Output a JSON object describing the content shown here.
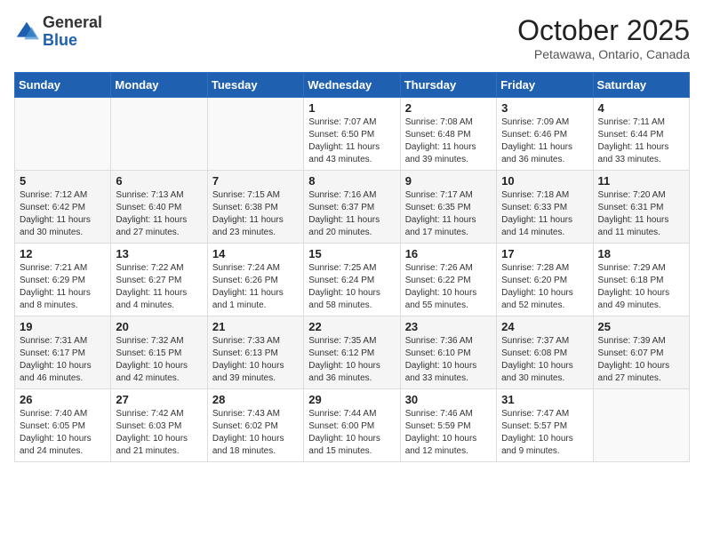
{
  "header": {
    "logo_general": "General",
    "logo_blue": "Blue",
    "month_title": "October 2025",
    "location": "Petawawa, Ontario, Canada"
  },
  "days_of_week": [
    "Sunday",
    "Monday",
    "Tuesday",
    "Wednesday",
    "Thursday",
    "Friday",
    "Saturday"
  ],
  "weeks": [
    [
      {
        "day": "",
        "sunrise": "",
        "sunset": "",
        "daylight": ""
      },
      {
        "day": "",
        "sunrise": "",
        "sunset": "",
        "daylight": ""
      },
      {
        "day": "",
        "sunrise": "",
        "sunset": "",
        "daylight": ""
      },
      {
        "day": "1",
        "sunrise": "Sunrise: 7:07 AM",
        "sunset": "Sunset: 6:50 PM",
        "daylight": "Daylight: 11 hours and 43 minutes."
      },
      {
        "day": "2",
        "sunrise": "Sunrise: 7:08 AM",
        "sunset": "Sunset: 6:48 PM",
        "daylight": "Daylight: 11 hours and 39 minutes."
      },
      {
        "day": "3",
        "sunrise": "Sunrise: 7:09 AM",
        "sunset": "Sunset: 6:46 PM",
        "daylight": "Daylight: 11 hours and 36 minutes."
      },
      {
        "day": "4",
        "sunrise": "Sunrise: 7:11 AM",
        "sunset": "Sunset: 6:44 PM",
        "daylight": "Daylight: 11 hours and 33 minutes."
      }
    ],
    [
      {
        "day": "5",
        "sunrise": "Sunrise: 7:12 AM",
        "sunset": "Sunset: 6:42 PM",
        "daylight": "Daylight: 11 hours and 30 minutes."
      },
      {
        "day": "6",
        "sunrise": "Sunrise: 7:13 AM",
        "sunset": "Sunset: 6:40 PM",
        "daylight": "Daylight: 11 hours and 27 minutes."
      },
      {
        "day": "7",
        "sunrise": "Sunrise: 7:15 AM",
        "sunset": "Sunset: 6:38 PM",
        "daylight": "Daylight: 11 hours and 23 minutes."
      },
      {
        "day": "8",
        "sunrise": "Sunrise: 7:16 AM",
        "sunset": "Sunset: 6:37 PM",
        "daylight": "Daylight: 11 hours and 20 minutes."
      },
      {
        "day": "9",
        "sunrise": "Sunrise: 7:17 AM",
        "sunset": "Sunset: 6:35 PM",
        "daylight": "Daylight: 11 hours and 17 minutes."
      },
      {
        "day": "10",
        "sunrise": "Sunrise: 7:18 AM",
        "sunset": "Sunset: 6:33 PM",
        "daylight": "Daylight: 11 hours and 14 minutes."
      },
      {
        "day": "11",
        "sunrise": "Sunrise: 7:20 AM",
        "sunset": "Sunset: 6:31 PM",
        "daylight": "Daylight: 11 hours and 11 minutes."
      }
    ],
    [
      {
        "day": "12",
        "sunrise": "Sunrise: 7:21 AM",
        "sunset": "Sunset: 6:29 PM",
        "daylight": "Daylight: 11 hours and 8 minutes."
      },
      {
        "day": "13",
        "sunrise": "Sunrise: 7:22 AM",
        "sunset": "Sunset: 6:27 PM",
        "daylight": "Daylight: 11 hours and 4 minutes."
      },
      {
        "day": "14",
        "sunrise": "Sunrise: 7:24 AM",
        "sunset": "Sunset: 6:26 PM",
        "daylight": "Daylight: 11 hours and 1 minute."
      },
      {
        "day": "15",
        "sunrise": "Sunrise: 7:25 AM",
        "sunset": "Sunset: 6:24 PM",
        "daylight": "Daylight: 10 hours and 58 minutes."
      },
      {
        "day": "16",
        "sunrise": "Sunrise: 7:26 AM",
        "sunset": "Sunset: 6:22 PM",
        "daylight": "Daylight: 10 hours and 55 minutes."
      },
      {
        "day": "17",
        "sunrise": "Sunrise: 7:28 AM",
        "sunset": "Sunset: 6:20 PM",
        "daylight": "Daylight: 10 hours and 52 minutes."
      },
      {
        "day": "18",
        "sunrise": "Sunrise: 7:29 AM",
        "sunset": "Sunset: 6:18 PM",
        "daylight": "Daylight: 10 hours and 49 minutes."
      }
    ],
    [
      {
        "day": "19",
        "sunrise": "Sunrise: 7:31 AM",
        "sunset": "Sunset: 6:17 PM",
        "daylight": "Daylight: 10 hours and 46 minutes."
      },
      {
        "day": "20",
        "sunrise": "Sunrise: 7:32 AM",
        "sunset": "Sunset: 6:15 PM",
        "daylight": "Daylight: 10 hours and 42 minutes."
      },
      {
        "day": "21",
        "sunrise": "Sunrise: 7:33 AM",
        "sunset": "Sunset: 6:13 PM",
        "daylight": "Daylight: 10 hours and 39 minutes."
      },
      {
        "day": "22",
        "sunrise": "Sunrise: 7:35 AM",
        "sunset": "Sunset: 6:12 PM",
        "daylight": "Daylight: 10 hours and 36 minutes."
      },
      {
        "day": "23",
        "sunrise": "Sunrise: 7:36 AM",
        "sunset": "Sunset: 6:10 PM",
        "daylight": "Daylight: 10 hours and 33 minutes."
      },
      {
        "day": "24",
        "sunrise": "Sunrise: 7:37 AM",
        "sunset": "Sunset: 6:08 PM",
        "daylight": "Daylight: 10 hours and 30 minutes."
      },
      {
        "day": "25",
        "sunrise": "Sunrise: 7:39 AM",
        "sunset": "Sunset: 6:07 PM",
        "daylight": "Daylight: 10 hours and 27 minutes."
      }
    ],
    [
      {
        "day": "26",
        "sunrise": "Sunrise: 7:40 AM",
        "sunset": "Sunset: 6:05 PM",
        "daylight": "Daylight: 10 hours and 24 minutes."
      },
      {
        "day": "27",
        "sunrise": "Sunrise: 7:42 AM",
        "sunset": "Sunset: 6:03 PM",
        "daylight": "Daylight: 10 hours and 21 minutes."
      },
      {
        "day": "28",
        "sunrise": "Sunrise: 7:43 AM",
        "sunset": "Sunset: 6:02 PM",
        "daylight": "Daylight: 10 hours and 18 minutes."
      },
      {
        "day": "29",
        "sunrise": "Sunrise: 7:44 AM",
        "sunset": "Sunset: 6:00 PM",
        "daylight": "Daylight: 10 hours and 15 minutes."
      },
      {
        "day": "30",
        "sunrise": "Sunrise: 7:46 AM",
        "sunset": "Sunset: 5:59 PM",
        "daylight": "Daylight: 10 hours and 12 minutes."
      },
      {
        "day": "31",
        "sunrise": "Sunrise: 7:47 AM",
        "sunset": "Sunset: 5:57 PM",
        "daylight": "Daylight: 10 hours and 9 minutes."
      },
      {
        "day": "",
        "sunrise": "",
        "sunset": "",
        "daylight": ""
      }
    ]
  ]
}
